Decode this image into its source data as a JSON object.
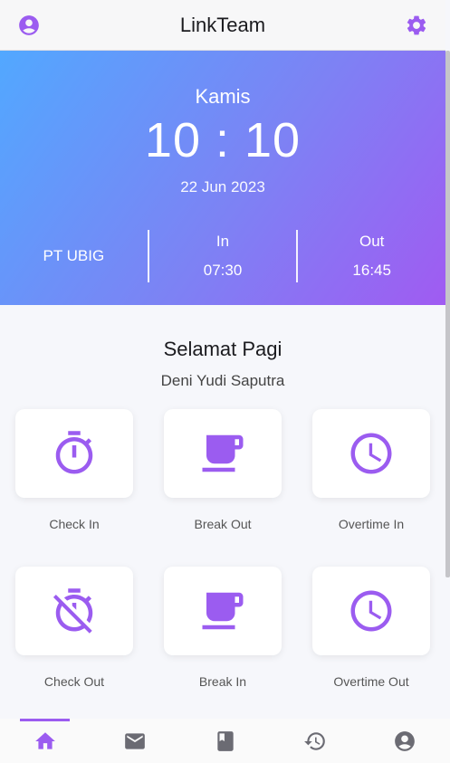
{
  "appbar": {
    "title": "LinkTeam",
    "left_icon": "account-circle-icon",
    "right_icon": "gear-icon"
  },
  "hero": {
    "day": "Kamis",
    "time": "10 : 10",
    "date": "22 Jun 2023",
    "company": "PT UBIG",
    "in_label": "In",
    "in_time": "07:30",
    "out_label": "Out",
    "out_time": "16:45"
  },
  "greeting": "Selamat Pagi",
  "user_name": "Deni Yudi Saputra",
  "actions": [
    {
      "label": "Check In",
      "icon": "timer-icon"
    },
    {
      "label": "Break Out",
      "icon": "coffee-cup-icon"
    },
    {
      "label": "Overtime In",
      "icon": "clock-icon"
    },
    {
      "label": "Check Out",
      "icon": "timer-off-icon"
    },
    {
      "label": "Break In",
      "icon": "coffee-cup-icon"
    },
    {
      "label": "Overtime Out",
      "icon": "clock-icon"
    }
  ],
  "bottom_nav": [
    {
      "icon": "home-icon",
      "active": true
    },
    {
      "icon": "mail-icon",
      "active": false
    },
    {
      "icon": "book-icon",
      "active": false
    },
    {
      "icon": "history-icon",
      "active": false
    },
    {
      "icon": "account-circle-icon",
      "active": false
    }
  ],
  "colors": {
    "accent": "#9b5cf0",
    "gradient_start": "#52a8ff",
    "gradient_end": "#a05bf2",
    "nav_inactive": "#6b6b73"
  }
}
